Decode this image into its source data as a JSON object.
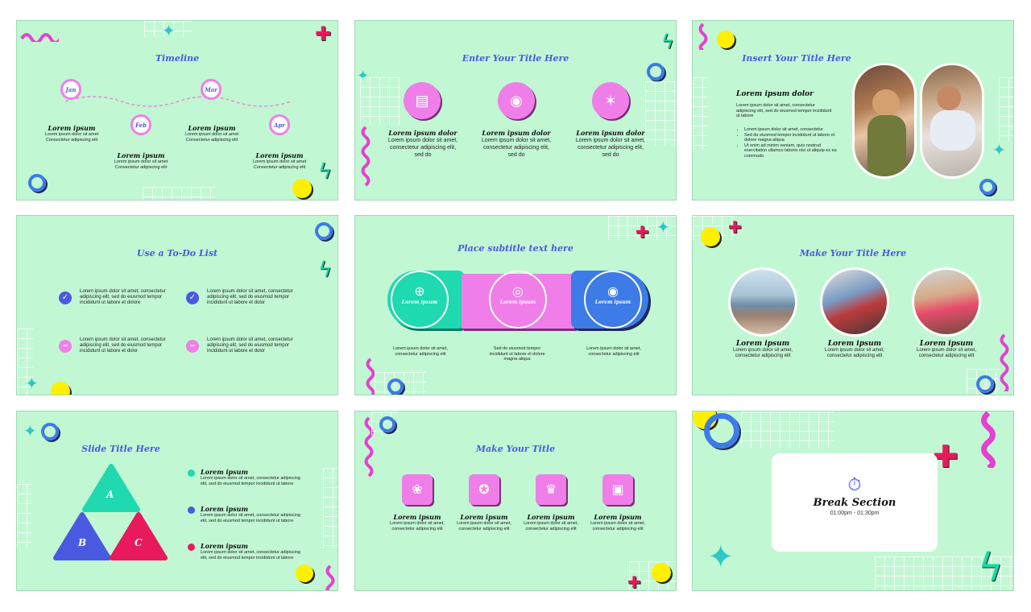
{
  "slides": {
    "timeline": {
      "title": "Timeline",
      "months": [
        "Jan",
        "Feb",
        "Mar",
        "Apr"
      ],
      "items": [
        {
          "heading": "Lorem ipsum",
          "text": "Lorem ipsum dolor sit amet Consectetur adipiscing elit"
        },
        {
          "heading": "Lorem ipsum",
          "text": "Lorem ipsum dolor sit amet Consectetur adipiscing elit"
        },
        {
          "heading": "Lorem ipsum",
          "text": "Lorem ipsum dolor sit amet Consectetur adipiscing elit"
        },
        {
          "heading": "Lorem ipsum",
          "text": "Lorem ipsum dolor sit amet Consectetur adipiscing elit"
        }
      ]
    },
    "enter_title": {
      "title": "Enter Your Title Here",
      "items": [
        {
          "heading": "Lorem ipsum dolor",
          "text": "Lorem ipsum dolor sit amet, consectetur adipiscing elit, sed do",
          "icon": "music-player-icon"
        },
        {
          "heading": "Lorem ipsum dolor",
          "text": "Lorem ipsum dolor sit amet, consectetur adipiscing elit, sed do",
          "icon": "camera-icon"
        },
        {
          "heading": "Lorem ipsum dolor",
          "text": "Lorem ipsum dolor sit amet, consectetur adipiscing elit, sed do",
          "icon": "party-popper-icon"
        }
      ]
    },
    "insert_title": {
      "title": "Insert Your Title Here",
      "heading": "Lorem ipsum dolor",
      "text": "Lorem ipsum dolor sit amet, consectetur adipiscing elit, sed do eiusmod tempor incididunt ut labore",
      "bullets": [
        "Lorem ipsum dolor sit amet, consectetur",
        "Sed do eiusmod tempor incididunt ut labore et dolore magna aliqua",
        "Ut enim ad minim veniam, quis nostrud exercitation ullamco laboris nisi ut aliquip ex ea commodo"
      ]
    },
    "todo": {
      "title": "Use a To-Do List",
      "items": [
        "Lorem ipsum dolor sit amet, consectetur adipiscing elit, sed do eiusmod tempor incididunt ut labore et dolore",
        "Lorem ipsum dolor sit amet, consectetur adipiscing elit, sed do eiusmod tempor incididunt ut labore et dolor",
        "Lorem ipsum dolor sit amet, consectetur adipiscing elit, sed do eiusmod tempor incididunt ut labore et dolor",
        "Lorem ipsum dolor sit amet, consectetur adipiscing elit, sed do eiusmod tempor incididunt ut labore et dolor"
      ]
    },
    "puzzle": {
      "title": "Place subtitle text here",
      "pieces": [
        "Lorem ipsum",
        "Lorem ipsum",
        "Lorem ipsum"
      ],
      "captions": [
        "Lorem ipsum dolor sit amet, consectetur adipiscing elit",
        "Sed do eiusmod tempor incididunt ut labore et dolore magna aliqua",
        "Lorem ipsum dolor sit amet, consectetur adipiscing elit"
      ],
      "colors": [
        "#1fd9b0",
        "#f07ee8",
        "#3d7be6"
      ]
    },
    "make_title_here": {
      "title": "Make Your Title Here",
      "items": [
        {
          "heading": "Lorem ipsum",
          "text": "Lorem ipsum dolor sit amet, consectetur adipiscing elit"
        },
        {
          "heading": "Lorem ipsum",
          "text": "Lorem ipsum dolor sit amet, consectetur adipiscing elit"
        },
        {
          "heading": "Lorem ipsum",
          "text": "Lorem ipsum dolor sit amet, consectetur adipiscing elit"
        }
      ]
    },
    "slide_title": {
      "title": "Slide Title Here",
      "triangles": [
        "A",
        "B",
        "C"
      ],
      "items": [
        {
          "heading": "Lorem ipsum",
          "text": "Lorem ipsum dolor sit amet, consectetur adipiscing elit, sed do eiusmod tempor incididunt ut labore",
          "color": "#1fd9b0"
        },
        {
          "heading": "Lorem ipsum",
          "text": "Lorem ipsum dolor sit amet, consectetur adipiscing elit, sed do eiusmod tempor incididunt ut labore",
          "color": "#4a5ae0"
        },
        {
          "heading": "Lorem ipsum",
          "text": "Lorem ipsum dolor sit amet, consectetur adipiscing elit, sed do eiusmod tempor incididunt ut labore",
          "color": "#e8195d"
        }
      ]
    },
    "make_title": {
      "title": "Make Your Title",
      "items": [
        {
          "heading": "Lorem ipsum",
          "text": "Lorem ipsum dolor sit amet, consectetur adipiscing elit",
          "icon": "award-badge-icon"
        },
        {
          "heading": "Lorem ipsum",
          "text": "Lorem ipsum dolor sit amet, consectetur adipiscing elit",
          "icon": "medal-icon"
        },
        {
          "heading": "Lorem ipsum",
          "text": "Lorem ipsum dolor sit amet, consectetur adipiscing elit",
          "icon": "trophy-icon"
        },
        {
          "heading": "Lorem ipsum",
          "text": "Lorem ipsum dolor sit amet, consectetur adipiscing elit",
          "icon": "certificate-icon"
        }
      ]
    },
    "break_section": {
      "title": "Break Section",
      "time": "01:00pm - 01:30pm",
      "icon": "stopwatch-icon"
    }
  }
}
